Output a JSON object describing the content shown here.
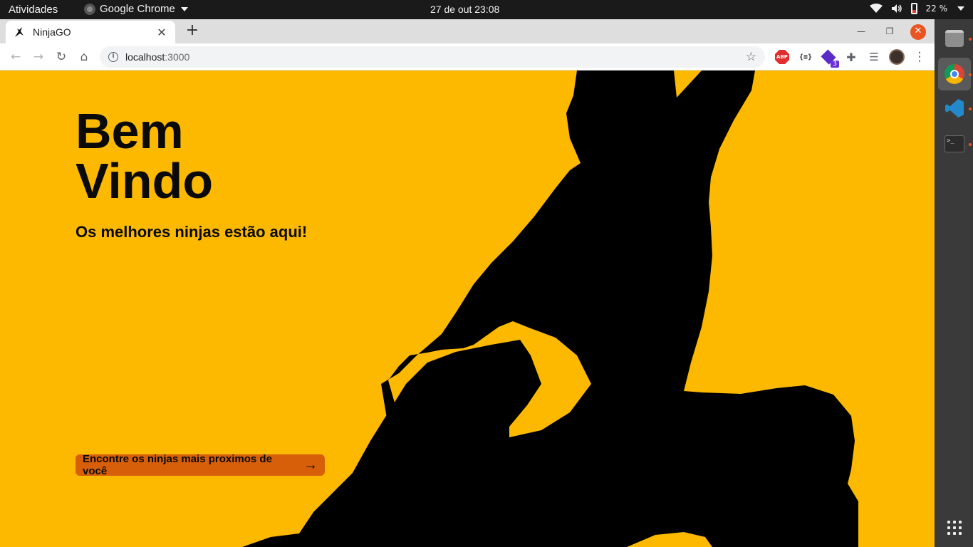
{
  "system_bar": {
    "activities": "Atividades",
    "app_name": "Google Chrome",
    "datetime": "27 de out  23:08",
    "battery": "22 %"
  },
  "browser": {
    "tab_title": "NinjaGO",
    "url_host": "localhost",
    "url_port": ":3000",
    "extensions": {
      "abp": "ABP",
      "json": "{≡}",
      "badge_count": "3"
    }
  },
  "page": {
    "title_line1": "Bem",
    "title_line2": "Vindo",
    "subtitle": "Os melhores ninjas estão aqui!",
    "cta_label": "Encontre os ninjas mais proximos de você",
    "colors": {
      "background": "#fcb900",
      "cta": "#d75f0a",
      "text": "#0a0a0a"
    }
  },
  "dock": {
    "apps": [
      "files-icon",
      "chrome-icon",
      "vscode-icon",
      "terminal-icon"
    ],
    "terminal_glyph": ">_"
  }
}
